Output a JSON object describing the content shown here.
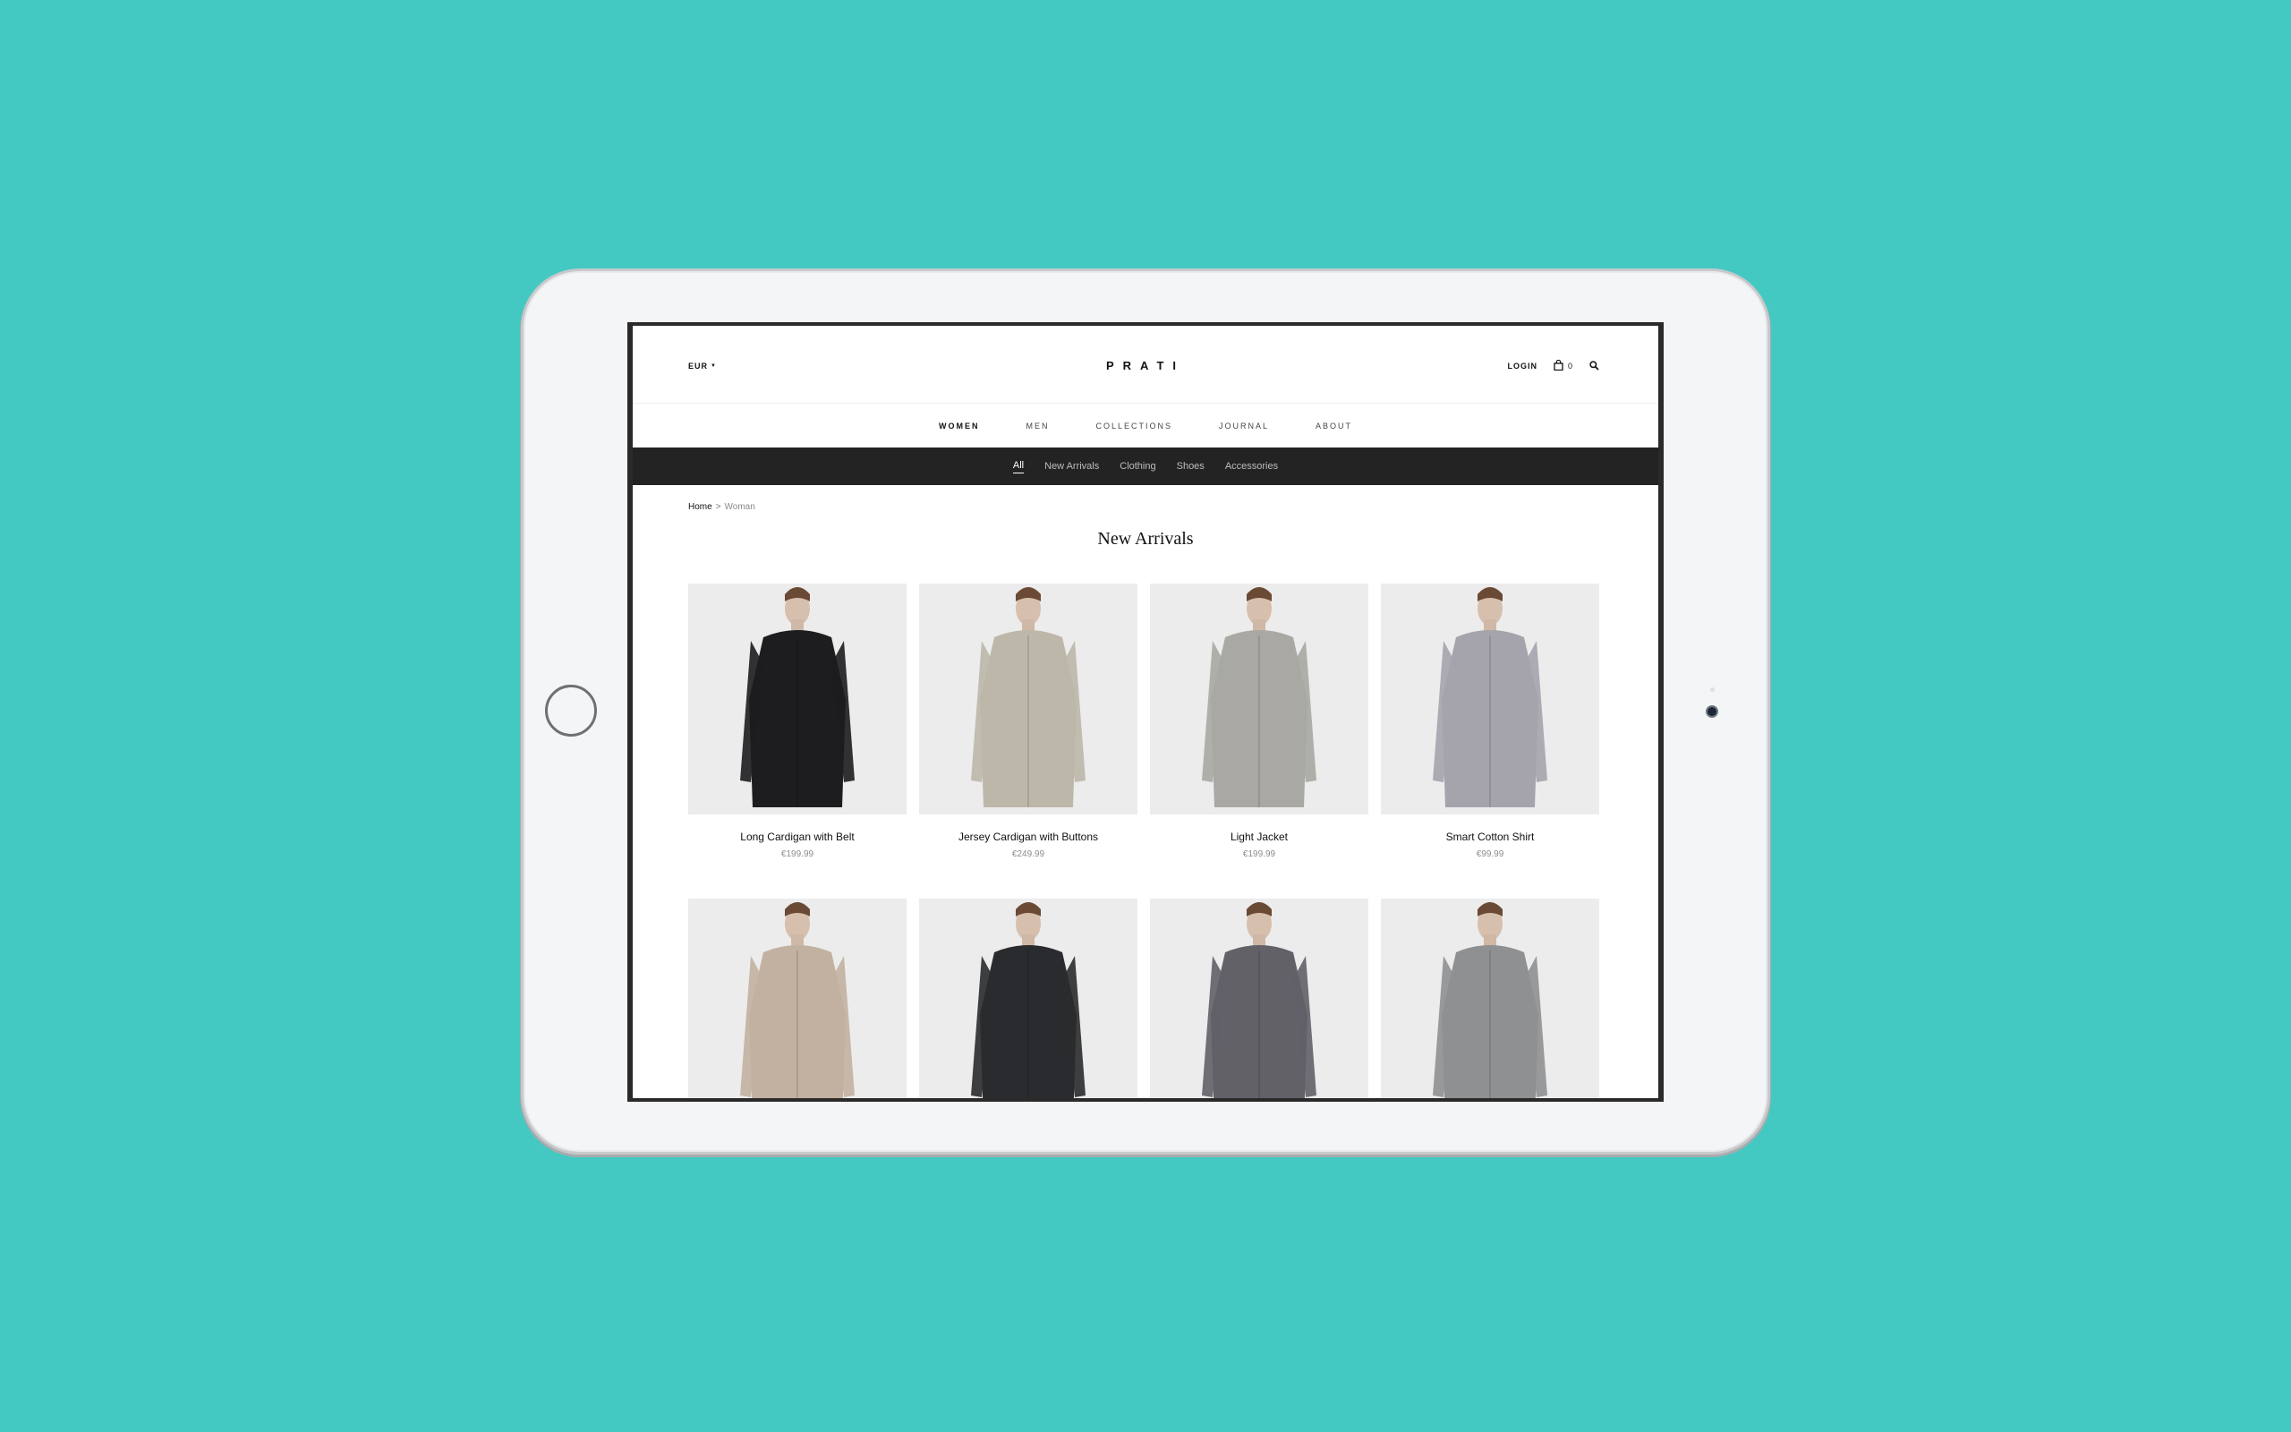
{
  "header": {
    "currency": "EUR",
    "logo": "PRATI",
    "login": "LOGIN",
    "cart_count": "0"
  },
  "main_nav": [
    "WOMEN",
    "MEN",
    "COLLECTIONS",
    "JOURNAL",
    "ABOUT"
  ],
  "sub_nav": [
    "All",
    "New Arrivals",
    "Clothing",
    "Shoes",
    "Accessories"
  ],
  "breadcrumb": {
    "home": "Home",
    "separator": ">",
    "current": "Woman"
  },
  "page_title": "New Arrivals",
  "products": [
    {
      "name": "Long Cardigan with Belt",
      "price": "€199.99",
      "color": "#1d1d1f"
    },
    {
      "name": "Jersey Cardigan with Buttons",
      "price": "€249.99",
      "color": "#bdb7aa"
    },
    {
      "name": "Light Jacket",
      "price": "€199.99",
      "color": "#a9a8a3"
    },
    {
      "name": "Smart Cotton Shirt",
      "price": "€99.99",
      "color": "#a5a4ad"
    },
    {
      "name": "",
      "price": "",
      "color": "#c2b1a1"
    },
    {
      "name": "",
      "price": "",
      "color": "#2a2b2e"
    },
    {
      "name": "",
      "price": "",
      "color": "#626168"
    },
    {
      "name": "",
      "price": "",
      "color": "#8f9092"
    }
  ],
  "colors": {
    "background": "#44c8c2",
    "subnav_bg": "#232323"
  }
}
